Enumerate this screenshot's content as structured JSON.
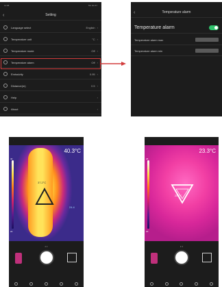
{
  "settings_screen": {
    "title": "Setting",
    "status_left": "11:08",
    "status_right": "5G 4G 67",
    "rows": [
      {
        "label": "Language select",
        "value": "English",
        "icon": "globe-icon"
      },
      {
        "label": "Temperature unit",
        "value": "°C",
        "icon": "thermometer-icon"
      },
      {
        "label": "Temperature mode",
        "value": "Off",
        "icon": "target-icon"
      },
      {
        "label": "Temperature alarm",
        "value": "Off",
        "icon": "alarm-icon"
      },
      {
        "label": "Emissivity",
        "value": "0.95",
        "icon": "sun-icon"
      },
      {
        "label": "Distance(m)",
        "value": "0.5",
        "icon": "ruler-icon"
      },
      {
        "label": "Help",
        "value": "",
        "icon": "help-icon"
      },
      {
        "label": "About",
        "value": "",
        "icon": "info-icon"
      }
    ]
  },
  "alarm_screen": {
    "title": "Temperature alarm",
    "toggle_label": "Temperature alarm",
    "toggle_on": true,
    "max_label": "Temperature alarm max",
    "max_value": "",
    "min_label": "Temperature alarm min",
    "min_value": ""
  },
  "camera_left": {
    "readout": "40.3°C",
    "scale_top": "40",
    "scale_bottom": "22",
    "center_label": "37.2°C",
    "spot_label": "24.4"
  },
  "camera_right": {
    "readout": "23.3°C",
    "scale_top": "25",
    "scale_bottom": "20",
    "center_label": "23.3°C"
  },
  "colors": {
    "highlight": "#d23b3b",
    "toggle_on": "#2fc26b",
    "arrow": "#d23b3b"
  }
}
